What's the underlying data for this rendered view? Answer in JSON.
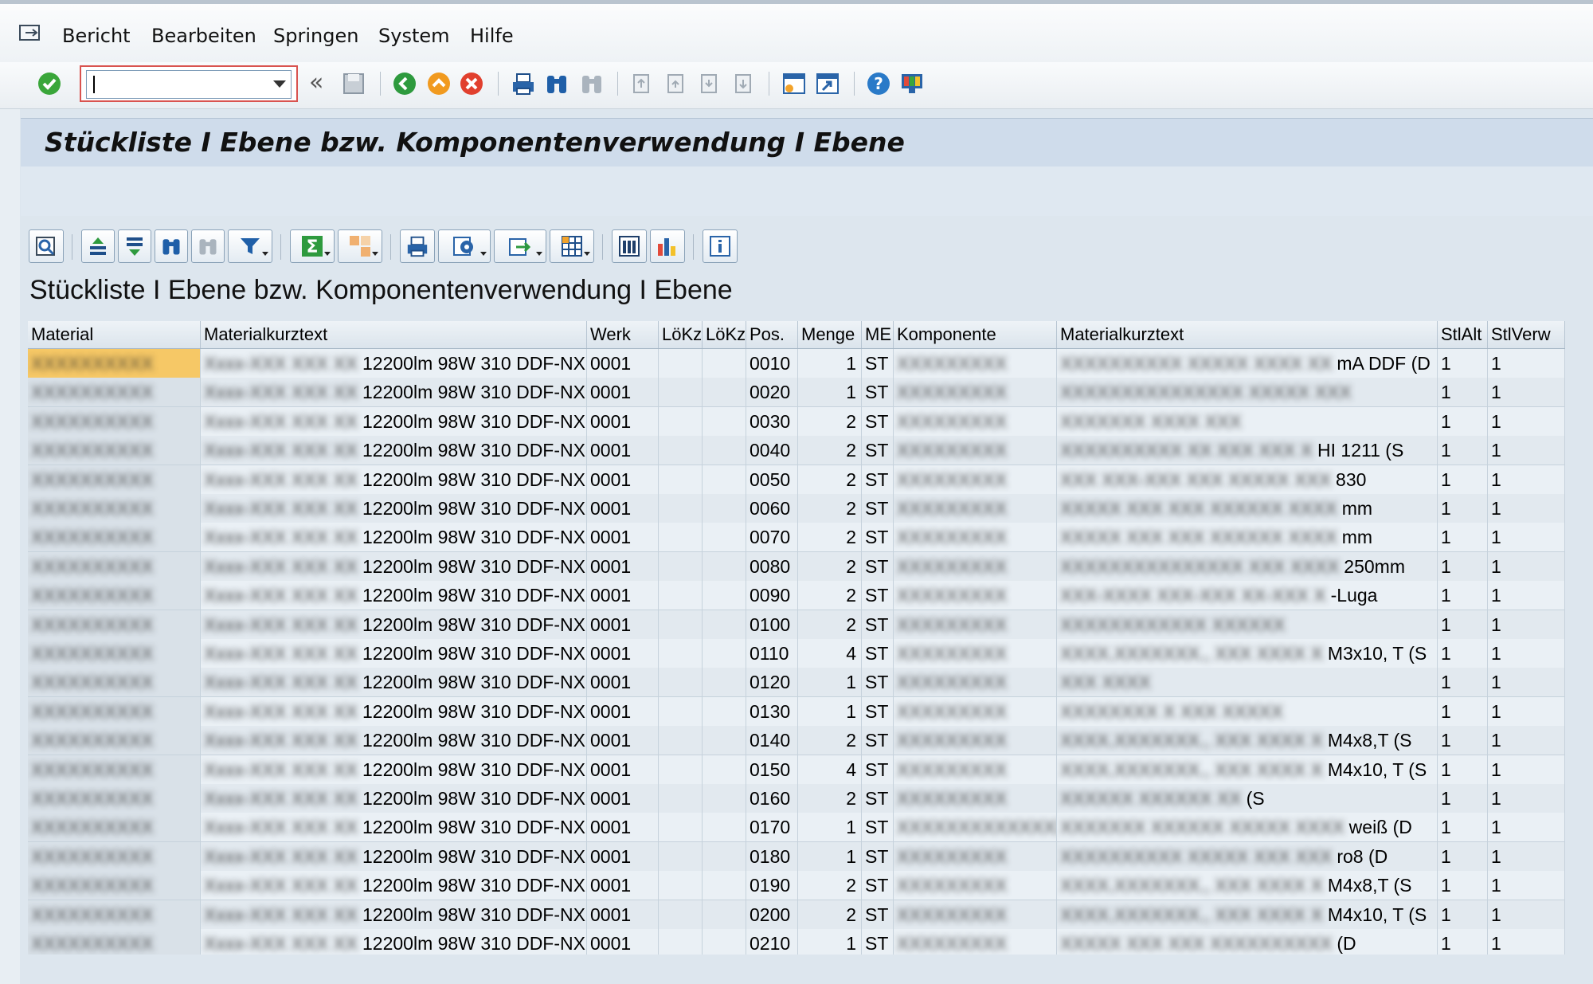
{
  "menu": {
    "items": [
      "Bericht",
      "Bearbeiten",
      "Springen",
      "System",
      "Hilfe"
    ]
  },
  "toolbar": {
    "command_value": "",
    "icons": [
      "enter-icon",
      "command-field",
      "back-icon",
      "save-icon",
      "back-green-icon",
      "exit-icon",
      "cancel-icon",
      "print-icon",
      "find-icon",
      "find-next-icon",
      "first-page-icon",
      "previous-page-icon",
      "next-page-icon",
      "last-page-icon",
      "create-session-icon",
      "shortcut-icon",
      "help-icon",
      "customize-layout-icon"
    ]
  },
  "header": {
    "title": "Stückliste I Ebene bzw. Komponentenverwendung I Ebene"
  },
  "list": {
    "title": "Stückliste I Ebene bzw. Komponentenverwendung I Ebene",
    "columns": [
      "Material",
      "Materialkurztext",
      "Werk",
      "LöKz",
      "LöKz",
      "Pos.",
      "Menge",
      "ME",
      "Komponente",
      "Materialkurztext",
      "StlAlt",
      "StlVerw"
    ],
    "rows": [
      {
        "material": "XXXXXXXXXX",
        "mtext_hidden": "Xxxx-XXX XXX XX",
        "mtext": "12200lm 98W 310 DDF-NX",
        "werk": "0001",
        "loekz1": "",
        "loekz2": "",
        "pos": "0010",
        "menge": "1",
        "me": "ST",
        "komp": "XXXXXXXXX",
        "ktext_hidden": "XXXXXXXXXX XXXXX XXXX XX",
        "ktext": "mA DDF    (D",
        "stlalt": "1",
        "stlverw": "1"
      },
      {
        "material": "XXXXXXXXXX",
        "mtext_hidden": "Xxxx-XXX XXX XX",
        "mtext": "12200lm 98W 310 DDF-NX",
        "werk": "0001",
        "loekz1": "",
        "loekz2": "",
        "pos": "0020",
        "menge": "1",
        "me": "ST",
        "komp": "XXXXXXXXX",
        "ktext_hidden": "XXXXXXXXXXXXXXX XXXXX XXX",
        "ktext": "",
        "stlalt": "1",
        "stlverw": "1"
      },
      {
        "material": "XXXXXXXXXX",
        "mtext_hidden": "Xxxx-XXX XXX XX",
        "mtext": "12200lm 98W 310 DDF-NX",
        "werk": "0001",
        "loekz1": "",
        "loekz2": "",
        "pos": "0030",
        "menge": "2",
        "me": "ST",
        "komp": "XXXXXXXXX",
        "ktext_hidden": "XXXXXXX XXXX XXX",
        "ktext": "",
        "stlalt": "1",
        "stlverw": "1"
      },
      {
        "material": "XXXXXXXXXX",
        "mtext_hidden": "Xxxx-XXX XXX XX",
        "mtext": "12200lm 98W 310 DDF-NX",
        "werk": "0001",
        "loekz1": "",
        "loekz2": "",
        "pos": "0040",
        "menge": "2",
        "me": "ST",
        "komp": "XXXXXXXXX",
        "ktext_hidden": "XXXXXXXXXX XX XXX XXX X",
        "ktext": "HI 1211 (S",
        "stlalt": "1",
        "stlverw": "1"
      },
      {
        "material": "XXXXXXXXXX",
        "mtext_hidden": "Xxxx-XXX XXX XX",
        "mtext": "12200lm 98W 310 DDF-NX",
        "werk": "0001",
        "loekz1": "",
        "loekz2": "",
        "pos": "0050",
        "menge": "2",
        "me": "ST",
        "komp": "XXXXXXXXX",
        "ktext_hidden": "XXX XXX-XXX XXX XXXXX XXX",
        "ktext": "830",
        "stlalt": "1",
        "stlverw": "1"
      },
      {
        "material": "XXXXXXXXXX",
        "mtext_hidden": "Xxxx-XXX XXX XX",
        "mtext": "12200lm 98W 310 DDF-NX",
        "werk": "0001",
        "loekz1": "",
        "loekz2": "",
        "pos": "0060",
        "menge": "2",
        "me": "ST",
        "komp": "XXXXXXXXX",
        "ktext_hidden": "XXXXX XXX XXX XXXXXX XXXX",
        "ktext": "mm",
        "stlalt": "1",
        "stlverw": "1"
      },
      {
        "material": "XXXXXXXXXX",
        "mtext_hidden": "Xxxx-XXX XXX XX",
        "mtext": "12200lm 98W 310 DDF-NX",
        "werk": "0001",
        "loekz1": "",
        "loekz2": "",
        "pos": "0070",
        "menge": "2",
        "me": "ST",
        "komp": "XXXXXXXXX",
        "ktext_hidden": "XXXXX XXX XXX XXXXXX XXXX",
        "ktext": "mm",
        "stlalt": "1",
        "stlverw": "1"
      },
      {
        "material": "XXXXXXXXXX",
        "mtext_hidden": "Xxxx-XXX XXX XX",
        "mtext": "12200lm 98W 310 DDF-NX",
        "werk": "0001",
        "loekz1": "",
        "loekz2": "",
        "pos": "0080",
        "menge": "2",
        "me": "ST",
        "komp": "XXXXXXXXX",
        "ktext_hidden": "XXXXXXXXXXXXXXX XXX XXXX",
        "ktext": "250mm",
        "stlalt": "1",
        "stlverw": "1"
      },
      {
        "material": "XXXXXXXXXX",
        "mtext_hidden": "Xxxx-XXX XXX XX",
        "mtext": "12200lm 98W 310 DDF-NX",
        "werk": "0001",
        "loekz1": "",
        "loekz2": "",
        "pos": "0090",
        "menge": "2",
        "me": "ST",
        "komp": "XXXXXXXXX",
        "ktext_hidden": "XXX-XXXX XXX-XXX XX-XXX X",
        "ktext": "-Luga",
        "stlalt": "1",
        "stlverw": "1"
      },
      {
        "material": "XXXXXXXXXX",
        "mtext_hidden": "Xxxx-XXX XXX XX",
        "mtext": "12200lm 98W 310 DDF-NX",
        "werk": "0001",
        "loekz1": "",
        "loekz2": "",
        "pos": "0100",
        "menge": "2",
        "me": "ST",
        "komp": "XXXXXXXXX",
        "ktext_hidden": "XXXXXXXXXXXX XXXXXX",
        "ktext": "",
        "stlalt": "1",
        "stlverw": "1"
      },
      {
        "material": "XXXXXXXXXX",
        "mtext_hidden": "Xxxx-XXX XXX XX",
        "mtext": "12200lm 98W 310 DDF-NX",
        "werk": "0001",
        "loekz1": "",
        "loekz2": "",
        "pos": "0110",
        "menge": "4",
        "me": "ST",
        "komp": "XXXXXXXXX",
        "ktext_hidden": "XXXX.XXXXXXX., XXX XXXX X",
        "ktext": "M3x10, T (S",
        "stlalt": "1",
        "stlverw": "1"
      },
      {
        "material": "XXXXXXXXXX",
        "mtext_hidden": "Xxxx-XXX XXX XX",
        "mtext": "12200lm 98W 310 DDF-NX",
        "werk": "0001",
        "loekz1": "",
        "loekz2": "",
        "pos": "0120",
        "menge": "1",
        "me": "ST",
        "komp": "XXXXXXXXX",
        "ktext_hidden": "XXX XXXX",
        "ktext": "",
        "stlalt": "1",
        "stlverw": "1"
      },
      {
        "material": "XXXXXXXXXX",
        "mtext_hidden": "Xxxx-XXX XXX XX",
        "mtext": "12200lm 98W 310 DDF-NX",
        "werk": "0001",
        "loekz1": "",
        "loekz2": "",
        "pos": "0130",
        "menge": "1",
        "me": "ST",
        "komp": "XXXXXXXXX",
        "ktext_hidden": "XXXXXXXX X XXX XXXXX",
        "ktext": "",
        "stlalt": "1",
        "stlverw": "1"
      },
      {
        "material": "XXXXXXXXXX",
        "mtext_hidden": "Xxxx-XXX XXX XX",
        "mtext": "12200lm 98W 310 DDF-NX",
        "werk": "0001",
        "loekz1": "",
        "loekz2": "",
        "pos": "0140",
        "menge": "2",
        "me": "ST",
        "komp": "XXXXXXXXX",
        "ktext_hidden": "XXXX.XXXXXXX., XXX XXXX X",
        "ktext": "M4x8,T    (S",
        "stlalt": "1",
        "stlverw": "1"
      },
      {
        "material": "XXXXXXXXXX",
        "mtext_hidden": "Xxxx-XXX XXX XX",
        "mtext": "12200lm 98W 310 DDF-NX",
        "werk": "0001",
        "loekz1": "",
        "loekz2": "",
        "pos": "0150",
        "menge": "4",
        "me": "ST",
        "komp": "XXXXXXXXX",
        "ktext_hidden": "XXXX.XXXXXXX., XXX XXXX X",
        "ktext": "M4x10, T (S",
        "stlalt": "1",
        "stlverw": "1"
      },
      {
        "material": "XXXXXXXXXX",
        "mtext_hidden": "Xxxx-XXX XXX XX",
        "mtext": "12200lm 98W 310 DDF-NX",
        "werk": "0001",
        "loekz1": "",
        "loekz2": "",
        "pos": "0160",
        "menge": "2",
        "me": "ST",
        "komp": "XXXXXXXXX",
        "ktext_hidden": "XXXXXX XXXXXX XX",
        "ktext": "(S",
        "stlalt": "1",
        "stlverw": "1"
      },
      {
        "material": "XXXXXXXXXX",
        "mtext_hidden": "Xxxx-XXX XXX XX",
        "mtext": "12200lm 98W 310 DDF-NX",
        "werk": "0001",
        "loekz1": "",
        "loekz2": "",
        "pos": "0170",
        "menge": "1",
        "me": "ST",
        "komp": "XXXXXXXXXXXXXXX",
        "ktext_hidden": "XXXXXXX XXXXXX XXXXX XXXX",
        "ktext": "weiß     (D",
        "stlalt": "1",
        "stlverw": "1"
      },
      {
        "material": "XXXXXXXXXX",
        "mtext_hidden": "Xxxx-XXX XXX XX",
        "mtext": "12200lm 98W 310 DDF-NX",
        "werk": "0001",
        "loekz1": "",
        "loekz2": "",
        "pos": "0180",
        "menge": "1",
        "me": "ST",
        "komp": "XXXXXXXXX",
        "ktext_hidden": "XXXXXXXXXX XXXXX XXX XXX",
        "ktext": "ro8     (D",
        "stlalt": "1",
        "stlverw": "1"
      },
      {
        "material": "XXXXXXXXXX",
        "mtext_hidden": "Xxxx-XXX XXX XX",
        "mtext": "12200lm 98W 310 DDF-NX",
        "werk": "0001",
        "loekz1": "",
        "loekz2": "",
        "pos": "0190",
        "menge": "2",
        "me": "ST",
        "komp": "XXXXXXXXX",
        "ktext_hidden": "XXXX.XXXXXXX., XXX XXXX X",
        "ktext": "M4x8,T    (S",
        "stlalt": "1",
        "stlverw": "1"
      },
      {
        "material": "XXXXXXXXXX",
        "mtext_hidden": "Xxxx-XXX XXX XX",
        "mtext": "12200lm 98W 310 DDF-NX",
        "werk": "0001",
        "loekz1": "",
        "loekz2": "",
        "pos": "0200",
        "menge": "2",
        "me": "ST",
        "komp": "XXXXXXXXX",
        "ktext_hidden": "XXXX.XXXXXXX., XXX XXXX X",
        "ktext": "M4x10, T (S",
        "stlalt": "1",
        "stlverw": "1"
      },
      {
        "material": "XXXXXXXXXX",
        "mtext_hidden": "Xxxx-XXX XXX XX",
        "mtext": "12200lm 98W 310 DDF-NX",
        "werk": "0001",
        "loekz1": "",
        "loekz2": "",
        "pos": "0210",
        "menge": "1",
        "me": "ST",
        "komp": "XXXXXXXXX",
        "ktext_hidden": "XXXXX XXX XXX XXXXXXXXXX",
        "ktext": "(D",
        "stlalt": "1",
        "stlverw": "1"
      }
    ]
  },
  "colors": {
    "selection": "#f6c866",
    "accent": "#cfdceb"
  }
}
